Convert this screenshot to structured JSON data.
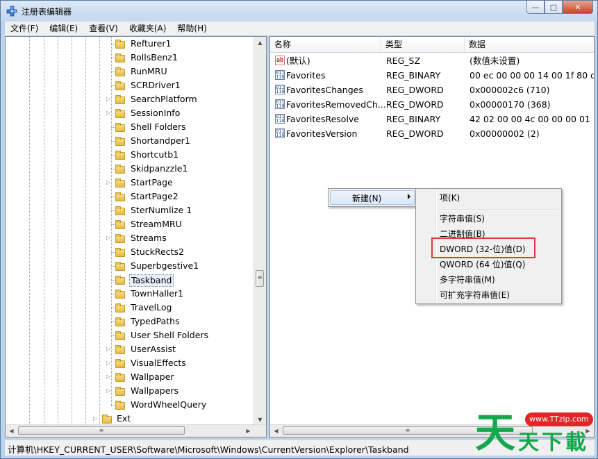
{
  "window": {
    "title": "注册表编辑器",
    "buttons": {
      "minimize": "—",
      "maximize": "□",
      "close": "✕"
    }
  },
  "menu": [
    "文件(F)",
    "编辑(E)",
    "查看(V)",
    "收藏夹(A)",
    "帮助(H)"
  ],
  "tree": {
    "items": [
      {
        "label": "Refturer1",
        "expandable": false
      },
      {
        "label": "RollsBenz1",
        "expandable": false
      },
      {
        "label": "RunMRU",
        "expandable": false
      },
      {
        "label": "SCRDriver1",
        "expandable": false
      },
      {
        "label": "SearchPlatform",
        "expandable": true
      },
      {
        "label": "SessionInfo",
        "expandable": true
      },
      {
        "label": "Shell Folders",
        "expandable": false
      },
      {
        "label": "Shortandper1",
        "expandable": false
      },
      {
        "label": "Shortcutb1",
        "expandable": false
      },
      {
        "label": "Skidpanzzle1",
        "expandable": false
      },
      {
        "label": "StartPage",
        "expandable": true
      },
      {
        "label": "StartPage2",
        "expandable": false
      },
      {
        "label": "SterNumlize 1",
        "expandable": false
      },
      {
        "label": "StreamMRU",
        "expandable": false
      },
      {
        "label": "Streams",
        "expandable": true
      },
      {
        "label": "StuckRects2",
        "expandable": false
      },
      {
        "label": "Superbgestive1",
        "expandable": false
      },
      {
        "label": "Taskband",
        "expandable": false,
        "selected": true
      },
      {
        "label": "TownHaller1",
        "expandable": false
      },
      {
        "label": "TravelLog",
        "expandable": false
      },
      {
        "label": "TypedPaths",
        "expandable": false
      },
      {
        "label": "User Shell Folders",
        "expandable": false
      },
      {
        "label": "UserAssist",
        "expandable": true
      },
      {
        "label": "VisualEffects",
        "expandable": true
      },
      {
        "label": "Wallpaper",
        "expandable": true
      },
      {
        "label": "Wallpapers",
        "expandable": true
      },
      {
        "label": "WordWheelQuery",
        "expandable": false
      }
    ],
    "parent_item": {
      "label": "Ext",
      "expandable": true
    }
  },
  "list": {
    "headers": {
      "name": "名称",
      "type": "类型",
      "data": "数据"
    },
    "rows": [
      {
        "icon": "string-value-icon",
        "icon_text": "ab",
        "name": "(默认)",
        "type": "REG_SZ",
        "data": "(数值未设置)"
      },
      {
        "icon": "binary-value-icon",
        "icon_text": "011 110",
        "name": "Favorites",
        "type": "REG_BINARY",
        "data": "00 ec 00 00 00 14 00 1f 80 c8"
      },
      {
        "icon": "binary-value-icon",
        "icon_text": "011 110",
        "name": "FavoritesChanges",
        "type": "REG_DWORD",
        "data": "0x000002c6 (710)"
      },
      {
        "icon": "binary-value-icon",
        "icon_text": "011 110",
        "name": "FavoritesRemovedCh...",
        "type": "REG_DWORD",
        "data": "0x00000170 (368)"
      },
      {
        "icon": "binary-value-icon",
        "icon_text": "011 110",
        "name": "FavoritesResolve",
        "type": "REG_BINARY",
        "data": "42 02 00 00 4c 00 00 00 01 14"
      },
      {
        "icon": "binary-value-icon",
        "icon_text": "011 110",
        "name": "FavoritesVersion",
        "type": "REG_DWORD",
        "data": "0x00000002 (2)"
      }
    ]
  },
  "context_menu": {
    "new_label": "新建(N)",
    "submenu": {
      "key": "项(K)",
      "items": [
        "字符串值(S)",
        "二进制值(B)",
        "DWORD (32-位)值(D)",
        "QWORD (64 位)值(Q)",
        "多字符串值(M)",
        "可扩充字符串值(E)"
      ],
      "highlighted": "DWORD (32-位)值(D)"
    }
  },
  "status": {
    "path": "计算机\\HKEY_CURRENT_USER\\Software\\Microsoft\\Windows\\CurrentVersion\\Explorer\\Taskband"
  },
  "watermark": {
    "big": "天",
    "small": [
      "天",
      "下",
      "載"
    ],
    "url": "www.TTzip.com"
  },
  "colors": {
    "highlight_box": "#e03a3a",
    "watermark_green": "#12a84c",
    "watermark_red": "#e02626"
  }
}
